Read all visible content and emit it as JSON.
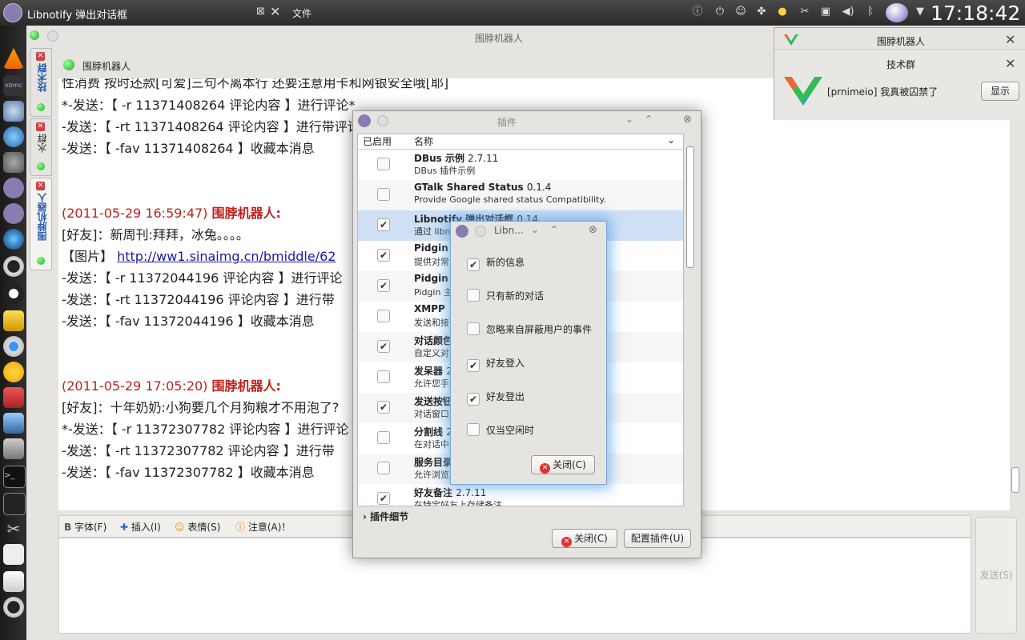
{
  "topbar": {
    "window_title": "Libnotify 弹出对话框",
    "menu_file": "文件",
    "clock": "17:18:42",
    "tray_icons": [
      "info-icon",
      "power-icon",
      "smiley-icon",
      "puzzle-icon",
      "sun-icon",
      "scissors-icon",
      "usb-icon",
      "volume-icon",
      "bluetooth-icon",
      "orb-icon",
      "chevron-down-icon"
    ]
  },
  "dock": {
    "icons": [
      "vlc-icon",
      "xbmc-icon",
      "network-icon",
      "fish-icon",
      "gimp-icon",
      "pidgin-icon",
      "pidgin-2-icon",
      "firefox-icon",
      "opera-icon",
      "tux-icon",
      "email-icon",
      "chrome-icon",
      "chromium-icon",
      "archive-icon",
      "file-manager-icon",
      "package-icon",
      "terminal-icon",
      "monitor-icon",
      "tools-icon",
      "document-icon",
      "text-editor-icon",
      "opera-2-icon"
    ]
  },
  "main_window": {
    "title": "围脖机器人",
    "tabs": [
      {
        "label": "技术群"
      },
      {
        "label": "水群"
      },
      {
        "label": "围脖机器人"
      }
    ],
    "conversation_title": "围脖机器人"
  },
  "chat": {
    "lines": [
      {
        "text": "性消费 按时还款[可爱]三句不离本行 还要注意用卡和网银安全哦[耶]"
      },
      {
        "text": "*-发送：【 -r 11371408264 评论内容 】进行评论*"
      },
      {
        "text": "-发送：【 -rt 11371408264 评论内容 】进行带评论转发"
      },
      {
        "text": "-发送：【 -fav 11371408264 】收藏本消息"
      },
      {
        "ts": "(2011-05-29 16:59:47)",
        "sender": "围脖机器人:"
      },
      {
        "text": "[好友]：新周刊:拜拜，冰兔。。。。"
      },
      {
        "text": "【图片】",
        "link": "http://ww1.sinaimg.cn/bmiddle/62"
      },
      {
        "text": "-发送：【 -r 11372044196 评论内容 】进行评论"
      },
      {
        "text": "-发送：【 -rt 11372044196 评论内容 】进行带"
      },
      {
        "text": "-发送：【 -fav 11372044196 】收藏本消息"
      },
      {
        "ts": "(2011-05-29 17:05:20)",
        "sender": "围脖机器人:"
      },
      {
        "text": "[好友]：十年奶奶:小狗要几个月狗粮才不用泡了?"
      },
      {
        "text": "*-发送：【 -r 11372307782 评论内容 】进行评论"
      },
      {
        "text": "-发送：【 -rt 11372307782 评论内容 】进行带"
      },
      {
        "text": "-发送：【 -fav 11372307782 】收藏本消息"
      }
    ]
  },
  "toolbar": {
    "font": "字体(F)",
    "insert": "插入(I)",
    "emoticon": "表情(S)",
    "attention": "注意(A)！",
    "send": "发送(S)"
  },
  "plugins": {
    "title": "插件",
    "col_enabled": "已启用",
    "col_name": "名称",
    "items": [
      {
        "name": "DBus 示例",
        "version": "2.7.11",
        "desc": "DBus 插件示例",
        "checked": ""
      },
      {
        "name": "GTalk Shared Status",
        "version": "0.1.4",
        "desc": "Provide Google shared status Compatibility.",
        "checked": ""
      },
      {
        "name": "Libnotify 弹出对话框",
        "version": "0.14",
        "desc": "通过 libnotify 显示弹出窗口",
        "checked": "✔"
      },
      {
        "name": "Pidgin",
        "version": "",
        "desc": "提供对常",
        "checked": "✔"
      },
      {
        "name": "Pidgin",
        "version": "",
        "desc": "Pidgin 主",
        "checked": "✔"
      },
      {
        "name": "XMPP",
        "version": "",
        "desc": "发送和接",
        "checked": ""
      },
      {
        "name": "对话颜色",
        "version": "",
        "desc": "自定义对",
        "checked": "✔"
      },
      {
        "name": "发呆器",
        "version": "2",
        "desc": "允许您手",
        "checked": ""
      },
      {
        "name": "发送按钮",
        "version": "",
        "desc": "对话窗口",
        "checked": "✔"
      },
      {
        "name": "分割线",
        "version": "2",
        "desc": "在对话中",
        "checked": ""
      },
      {
        "name": "服务目录",
        "version": "",
        "desc": "允许浏览",
        "checked": ""
      },
      {
        "name": "好友备注",
        "version": "2.7.11",
        "desc": "在特定好友上存储备注",
        "checked": "✔"
      }
    ],
    "details": "插件细节",
    "close": "关闭(C)",
    "configure": "配置插件(U)"
  },
  "libnotify": {
    "title": "Libn...",
    "options": [
      {
        "label": "新的信息",
        "checked": "✔"
      },
      {
        "label": "只有新的对话",
        "checked": ""
      },
      {
        "label": "忽略来自屏蔽用户的事件",
        "checked": ""
      },
      {
        "label": "好友登入",
        "checked": "✔"
      },
      {
        "label": "好友登出",
        "checked": "✔"
      },
      {
        "label": "仅当空闲时",
        "checked": ""
      }
    ],
    "close": "关闭(C)"
  },
  "notifications": {
    "outer_title": "围脖机器人",
    "inner_title": "技术群",
    "message": "[prnimeio] 我真被囚禁了",
    "show": "显示"
  }
}
